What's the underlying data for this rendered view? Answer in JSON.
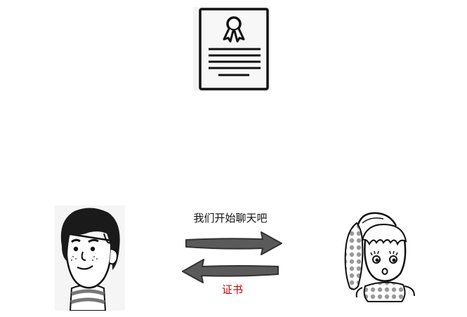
{
  "messages": {
    "chat_request": "我们开始聊天吧",
    "certificate_label": "证书"
  },
  "colors": {
    "certificate_label": "#cc0000",
    "arrow_fill": "#5a5a5a",
    "outline": "#111111"
  },
  "icons": {
    "document": "certificate-icon",
    "left_person": "boy-cartoon",
    "right_person": "girl-cartoon"
  }
}
